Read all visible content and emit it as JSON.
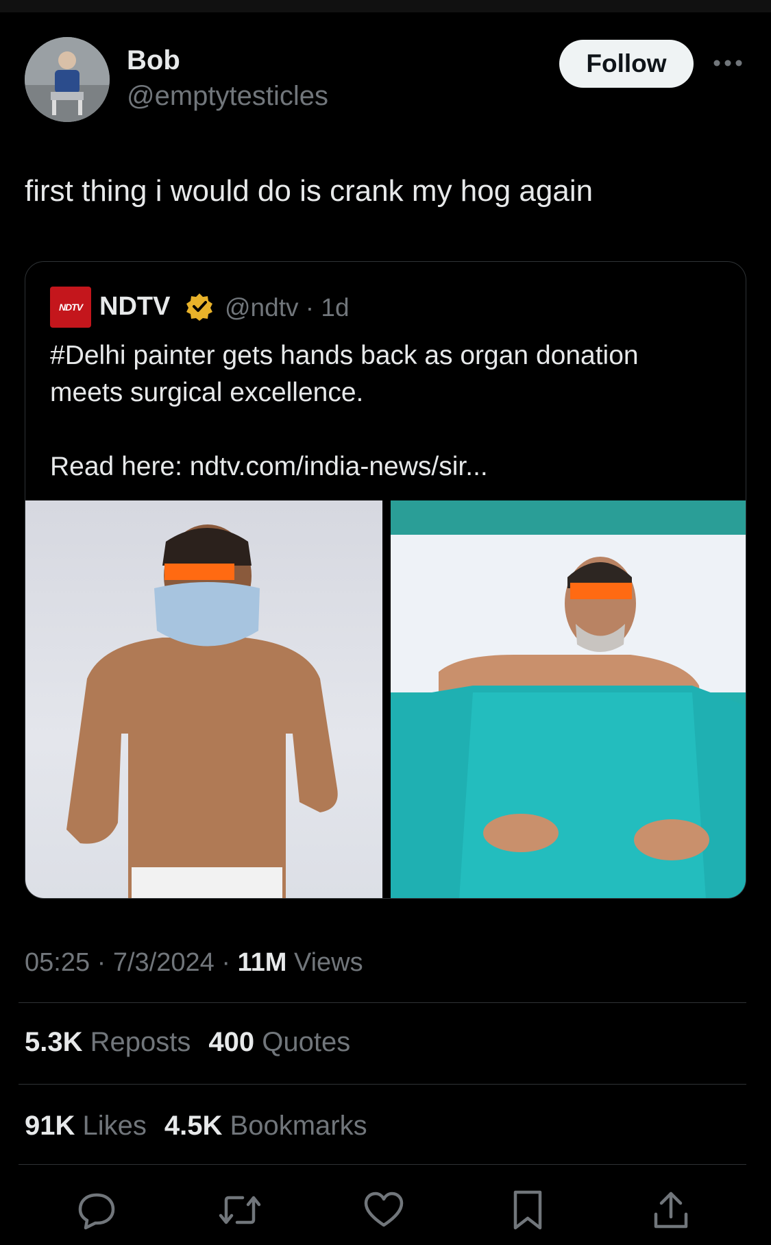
{
  "author": {
    "display_name": "Bob",
    "handle": "@emptytesticles",
    "follow_label": "Follow"
  },
  "tweet": {
    "text": "first thing i would do is crank my hog again"
  },
  "quoted": {
    "logo_text": "NDTV",
    "name": "NDTV",
    "handle_time": "@ndtv · 1d",
    "line1": "#Delhi painter gets hands back as organ donation",
    "line2": "meets surgical excellence.",
    "line3": "Read here: ndtv.com/india-news/sir..."
  },
  "meta": {
    "timestamp": "05:25 · 7/3/2024 · ",
    "views_count": "11M",
    "views_label": " Views"
  },
  "stats": {
    "reposts_count": "5.3K",
    "reposts_label": "Reposts",
    "quotes_count": "400",
    "quotes_label": "Quotes",
    "likes_count": "91K",
    "likes_label": "Likes",
    "bookmarks_count": "4.5K",
    "bookmarks_label": "Bookmarks"
  },
  "actions": [
    "reply-icon",
    "retweet-icon",
    "like-icon",
    "bookmark-icon",
    "share-icon"
  ],
  "colors": {
    "background": "#000000",
    "text": "#e7e9ea",
    "muted": "#71767b",
    "ndtv_red": "#c4161c",
    "verified_gold": "#e8b22a"
  }
}
